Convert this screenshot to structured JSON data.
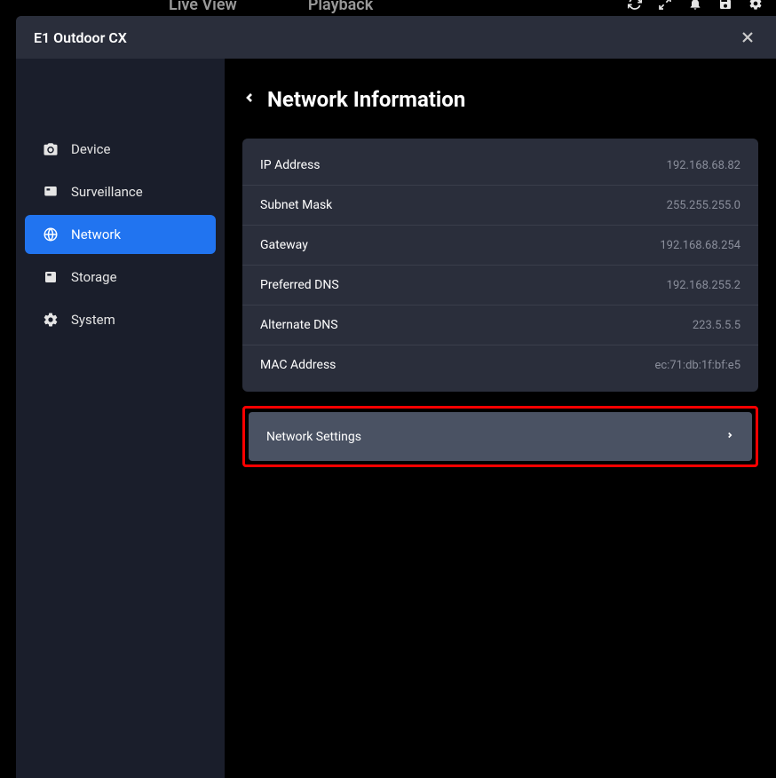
{
  "topNav": {
    "liveView": "Live View",
    "playback": "Playback"
  },
  "modal": {
    "title": "E1 Outdoor CX"
  },
  "sidebar": {
    "items": [
      {
        "label": "Device"
      },
      {
        "label": "Surveillance"
      },
      {
        "label": "Network"
      },
      {
        "label": "Storage"
      },
      {
        "label": "System"
      }
    ]
  },
  "page": {
    "title": "Network Information"
  },
  "info": {
    "ipAddress": {
      "label": "IP Address",
      "value": "192.168.68.82"
    },
    "subnetMask": {
      "label": "Subnet Mask",
      "value": "255.255.255.0"
    },
    "gateway": {
      "label": "Gateway",
      "value": "192.168.68.254"
    },
    "preferredDns": {
      "label": "Preferred DNS",
      "value": "192.168.255.2"
    },
    "alternateDns": {
      "label": "Alternate DNS",
      "value": "223.5.5.5"
    },
    "macAddress": {
      "label": "MAC Address",
      "value": "ec:71:db:1f:bf:e5"
    }
  },
  "settingsRow": {
    "label": "Network Settings"
  }
}
